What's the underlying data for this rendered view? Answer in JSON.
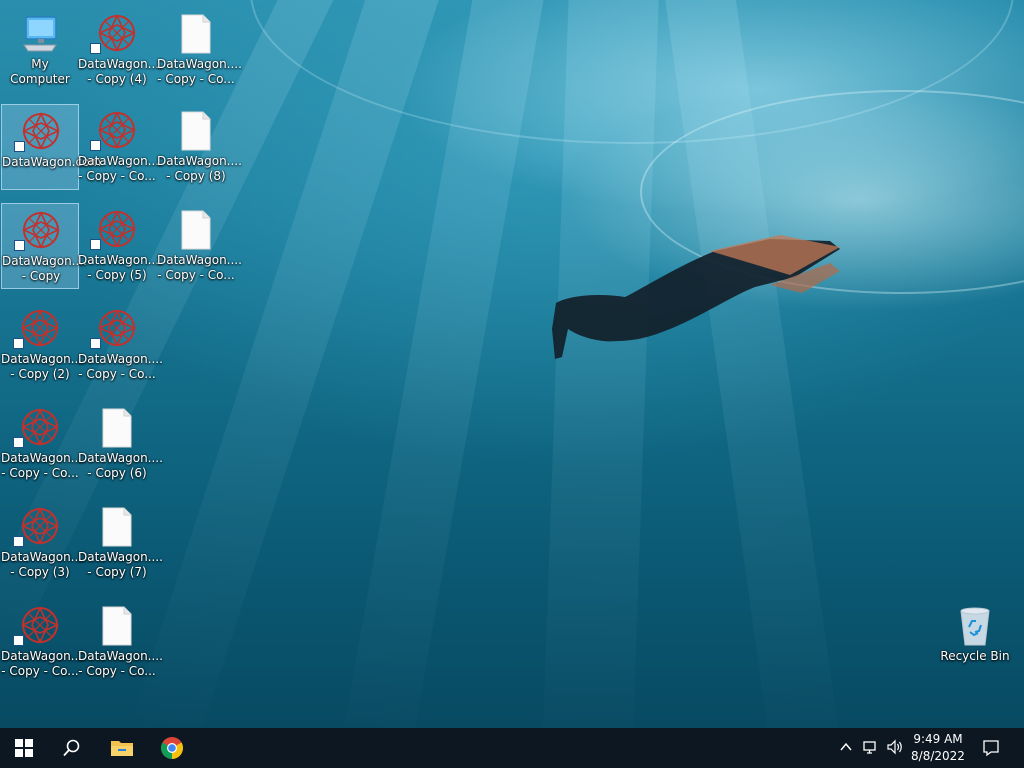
{
  "desktop": {
    "icons": [
      {
        "label": "My Computer",
        "type": "computer"
      },
      {
        "label": "DataWagon.... - Copy (4)",
        "type": "datawagon"
      },
      {
        "label": "DataWagon.... - Copy - Co...",
        "type": "file"
      },
      {
        "label": "DataWagon.com",
        "type": "datawagon"
      },
      {
        "label": "DataWagon.... - Copy - Co...",
        "type": "datawagon"
      },
      {
        "label": "DataWagon.... - Copy (8)",
        "type": "file"
      },
      {
        "label": "DataWagon.... - Copy",
        "type": "datawagon"
      },
      {
        "label": "DataWagon.... - Copy (5)",
        "type": "datawagon"
      },
      {
        "label": "DataWagon.... - Copy - Co...",
        "type": "file"
      },
      {
        "label": "DataWagon.... - Copy (2)",
        "type": "datawagon"
      },
      {
        "label": "DataWagon.... - Copy - Co...",
        "type": "datawagon"
      },
      {
        "label": "DataWagon.... - Copy - Co...",
        "type": "datawagon"
      },
      {
        "label": "DataWagon.... - Copy (6)",
        "type": "file"
      },
      {
        "label": "DataWagon.... - Copy (3)",
        "type": "datawagon"
      },
      {
        "label": "DataWagon.... - Copy (7)",
        "type": "file"
      },
      {
        "label": "DataWagon.... - Copy - Co...",
        "type": "datawagon"
      },
      {
        "label": "DataWagon.... - Copy - Co...",
        "type": "file"
      },
      {
        "label": "Recycle Bin",
        "type": "recycle-bin"
      }
    ]
  },
  "taskbar": {
    "pinned": [
      {
        "icon": "windows-start-icon"
      },
      {
        "icon": "search-icon"
      },
      {
        "icon": "file-explorer-icon"
      },
      {
        "icon": "chrome-icon"
      }
    ],
    "tray": {
      "time": "9:49 AM",
      "date": "8/8/2022",
      "icons": [
        "chevron-up-icon",
        "network-icon",
        "volume-icon",
        "notification-icon"
      ]
    }
  },
  "colors": {
    "taskbar": "#0c1722",
    "accent_red": "#c4302b",
    "selection": "#96c8e6"
  }
}
